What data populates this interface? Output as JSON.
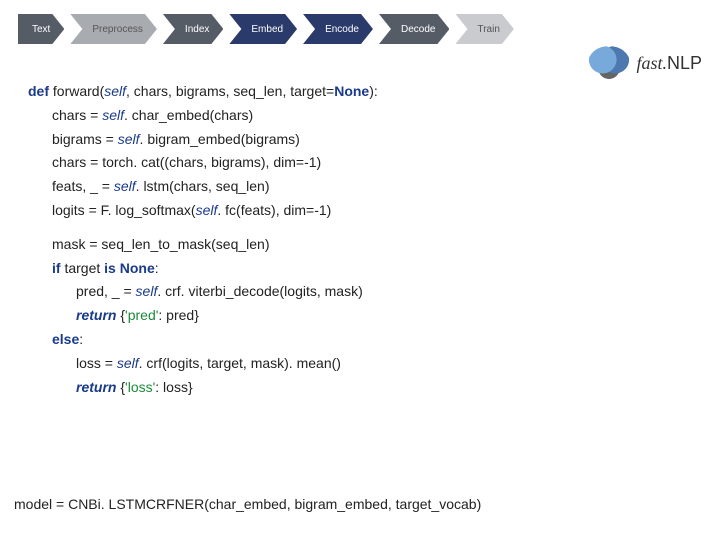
{
  "pipeline": {
    "steps": [
      "Text",
      "Preprocess",
      "Index",
      "Embed",
      "Encode",
      "Decode",
      "Train"
    ]
  },
  "brand": {
    "fast": "fast.",
    "nlp": "NLP"
  },
  "code": {
    "def": "def",
    "forward": " forward(",
    "self": "self",
    "forward_rest": ", chars, bigrams, seq_len, target=",
    "none": "None",
    "close_def": "):",
    "l1a": "chars = ",
    "l1b": ". char_embed(chars)",
    "l2a": "bigrams = ",
    "l2b": ". bigram_embed(bigrams)",
    "l3": "chars = torch. cat((chars, bigrams), dim=-1)",
    "l4a": "feats, _ = ",
    "l4b": ". lstm(chars, seq_len)",
    "l5a": "logits = F. log_softmax(",
    "l5b": ". fc(feats), dim=-1)",
    "l6": "mask = seq_len_to_mask(seq_len)",
    "if": "if",
    "is": "is",
    "none2": "None",
    "if_mid": " target ",
    "if_end": ":",
    "l7a": "pred, _ = ",
    "l7b": ". crf. viterbi_decode(logits, mask)",
    "ret": "return",
    "ret1a": " {",
    "ret1s": "'pred'",
    "ret1b": ": pred}",
    "else": "else",
    "else_end": ":",
    "l8a": "loss = ",
    "l8b": ". crf(logits, target, mask). mean()",
    "ret2a": " {",
    "ret2s": "'loss'",
    "ret2b": ": loss}"
  },
  "footer": "model = CNBi. LSTMCRFNER(char_embed, bigram_embed, target_vocab)"
}
